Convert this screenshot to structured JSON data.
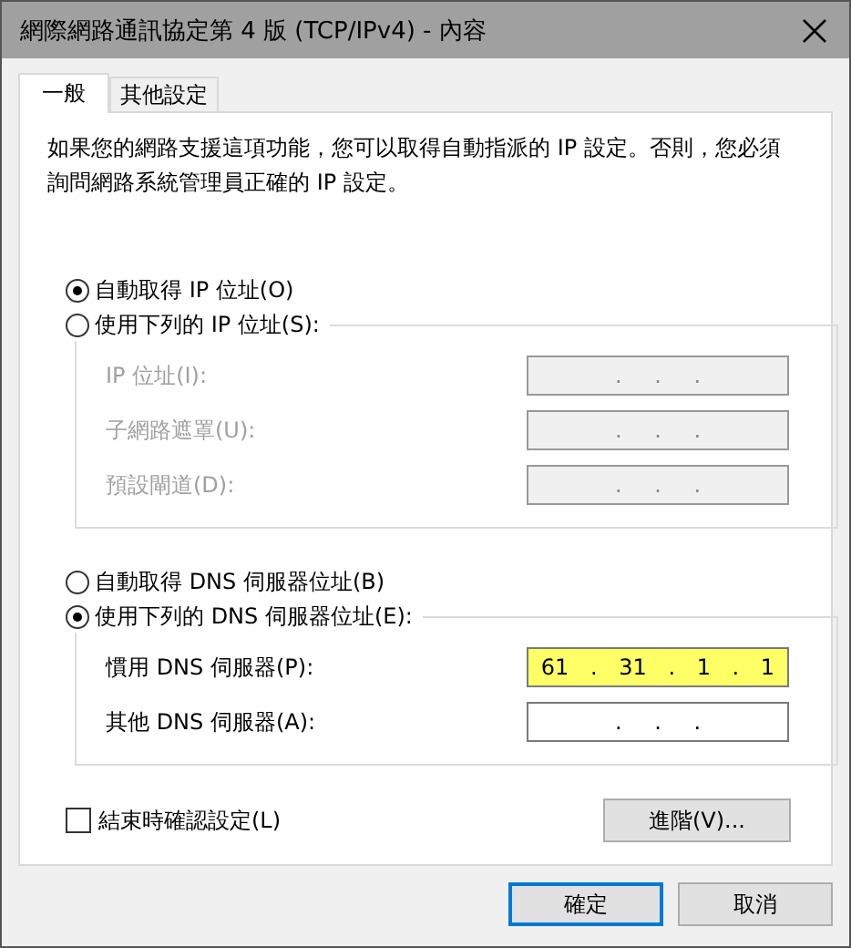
{
  "window": {
    "title": "網際網路通訊協定第 4 版 (TCP/IPv4) - 內容"
  },
  "tabs": [
    {
      "label": "一般",
      "selected": true
    },
    {
      "label": "其他設定",
      "selected": false
    }
  ],
  "description": "如果您的網路支援這項功能，您可以取得自動指派的 IP 設定。否則，您必須詢問網路系統管理員正確的 IP 設定。",
  "ip_section": {
    "auto_option": {
      "label": "自動取得 IP 位址(O)",
      "selected": true
    },
    "manual_option": {
      "label": "使用下列的 IP 位址(S):",
      "selected": false
    },
    "fields": [
      {
        "label": "IP 位址(I):",
        "value": ". . .",
        "disabled": true,
        "highlighted": false
      },
      {
        "label": "子網路遮罩(U):",
        "value": ". . .",
        "disabled": true,
        "highlighted": false
      },
      {
        "label": "預設閘道(D):",
        "value": ". . .",
        "disabled": true,
        "highlighted": false
      }
    ]
  },
  "dns_section": {
    "auto_option": {
      "label": "自動取得 DNS 伺服器位址(B)",
      "selected": false
    },
    "manual_option": {
      "label": "使用下列的 DNS 伺服器位址(E):",
      "selected": true
    },
    "fields": [
      {
        "label": "慣用 DNS 伺服器(P):",
        "value": "61 . 31 . 1 . 1",
        "disabled": false,
        "highlighted": true
      },
      {
        "label": "其他 DNS 伺服器(A):",
        "value": ". . .",
        "disabled": false,
        "highlighted": false
      }
    ]
  },
  "confirm_on_exit": {
    "label": "結束時確認設定(L)",
    "checked": false
  },
  "advanced_button": "進階(V)...",
  "buttons": [
    {
      "label": "確定",
      "default": true
    },
    {
      "label": "取消",
      "default": false
    }
  ]
}
